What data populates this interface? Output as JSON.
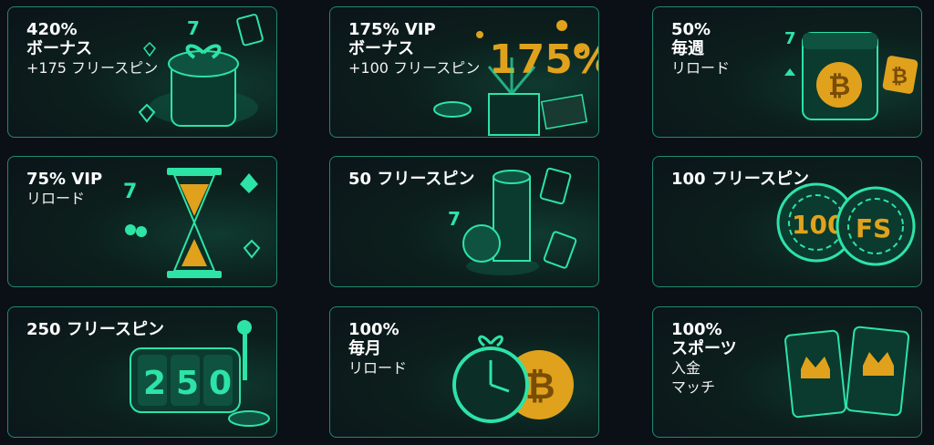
{
  "cards": [
    {
      "line1": "420%",
      "line2": "ボーナス",
      "line3": "+175 フリースピン"
    },
    {
      "line1": "175% VIP",
      "line2": "ボーナス",
      "line3": "+100 フリースピン",
      "art_text": "175%"
    },
    {
      "line1": "50%",
      "line2": "毎週",
      "line3": "リロード"
    },
    {
      "line1": "75% VIP",
      "line2": "リロード"
    },
    {
      "line1": "50 フリースピン"
    },
    {
      "line1": "100 フリースピン",
      "chip1": "100",
      "chip2": "FS"
    },
    {
      "line1": "250 フリースピン",
      "reel_digits": [
        "2",
        "5",
        "0"
      ]
    },
    {
      "line1": "100%",
      "line2": "毎月",
      "line3": "リロード"
    },
    {
      "line1": "100%",
      "line2": "スポーツ",
      "line3": "入金",
      "line4": "マッチ"
    }
  ],
  "colors": {
    "border": "#1f8a6f",
    "accent": "#2de3a6",
    "gold": "#e0a21c",
    "background": "#0b1016"
  },
  "icons": [
    "gift-box-icon",
    "treasure-chest-icon",
    "calendar-bitcoin-icon",
    "hourglass-icon",
    "chip-stack-icon",
    "chips-icon",
    "slot-reel-icon",
    "clock-coin-icon",
    "crown-cards-icon"
  ]
}
